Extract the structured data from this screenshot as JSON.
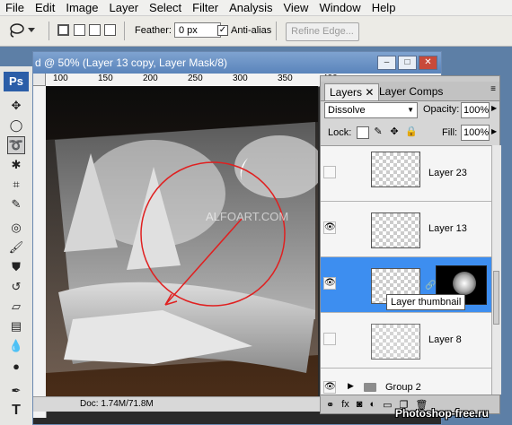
{
  "menu": [
    "File",
    "Edit",
    "Image",
    "Layer",
    "Select",
    "Filter",
    "Analysis",
    "View",
    "Window",
    "Help"
  ],
  "options": {
    "feather_label": "Feather:",
    "feather_value": "0 px",
    "antialias_label": "Anti-alias",
    "antialias_checked": true,
    "refine_edge_label": "Refine Edge..."
  },
  "toolbox": {
    "logo": "Ps",
    "tools": [
      "move-tool",
      "marquee-tool",
      "lasso-tool",
      "magic-wand-tool",
      "crop-tool",
      "eyedropper-tool",
      "healing-brush-tool",
      "brush-tool",
      "clone-stamp-tool",
      "history-brush-tool",
      "eraser-tool",
      "gradient-tool",
      "blur-tool",
      "dodge-tool",
      "pen-tool",
      "type-tool"
    ],
    "active_tool": "lasso-tool"
  },
  "document": {
    "title": "d @ 50% (Layer 13 copy, Layer Mask/8)",
    "ruler_labels": [
      "100",
      "150",
      "200",
      "250",
      "300",
      "350",
      "400"
    ],
    "status": "Doc: 1.74M/71.8M",
    "canvas_watermark": "ALFOART.COM"
  },
  "layers_panel": {
    "tabs": [
      "Layers",
      "Layer Comps"
    ],
    "blend_mode": "Dissolve",
    "opacity_label": "Opacity:",
    "opacity_value": "100%",
    "lock_label": "Lock:",
    "fill_label": "Fill:",
    "fill_value": "100%",
    "layers": [
      {
        "name": "Layer 23",
        "visible": false,
        "selected": false
      },
      {
        "name": "Layer 13",
        "visible": true,
        "selected": false
      },
      {
        "name": "",
        "visible": true,
        "selected": true
      },
      {
        "name": "Layer 8",
        "visible": false,
        "selected": false
      }
    ],
    "group_name": "Group 2",
    "tooltip": "Layer thumbnail"
  },
  "watermark": "Photoshop-free.ru",
  "colors": {
    "accent": "#3d8ef0",
    "title_bar": "#5a84bb",
    "circle": "#e02020"
  }
}
